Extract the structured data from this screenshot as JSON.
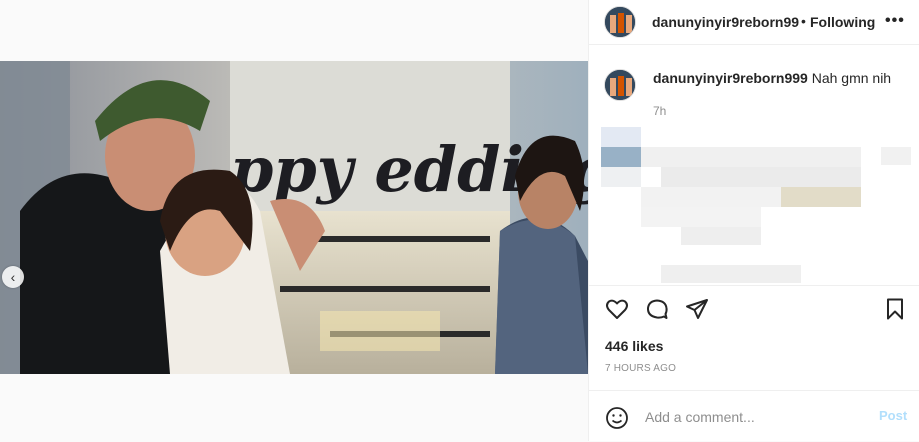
{
  "header": {
    "username": "danunyinyir9reborn99",
    "separator": "•",
    "follow_label": "Following",
    "more_label": "•••"
  },
  "caption": {
    "username": "danunyinyir9reborn999",
    "text": "Nah gmn nih",
    "time": "7h"
  },
  "media": {
    "slide_count": 5,
    "active_slide": 5,
    "prev_icon": "chevron-left-icon",
    "audio_icon": "speaker-icon",
    "scene_text": "ppy edding"
  },
  "actions": {
    "like_icon": "heart-icon",
    "comment_icon": "comment-icon",
    "share_icon": "send-icon",
    "save_icon": "bookmark-icon"
  },
  "likes": "446 likes",
  "time_ago": "7 HOURS AGO",
  "comment_box": {
    "placeholder": "Add a comment...",
    "post_label": "Post",
    "emoji_icon": "emoji-icon"
  },
  "colors": {
    "accent_disabled": "#b2dffc",
    "muted_text": "#8e8e8e",
    "border": "#efefef"
  }
}
